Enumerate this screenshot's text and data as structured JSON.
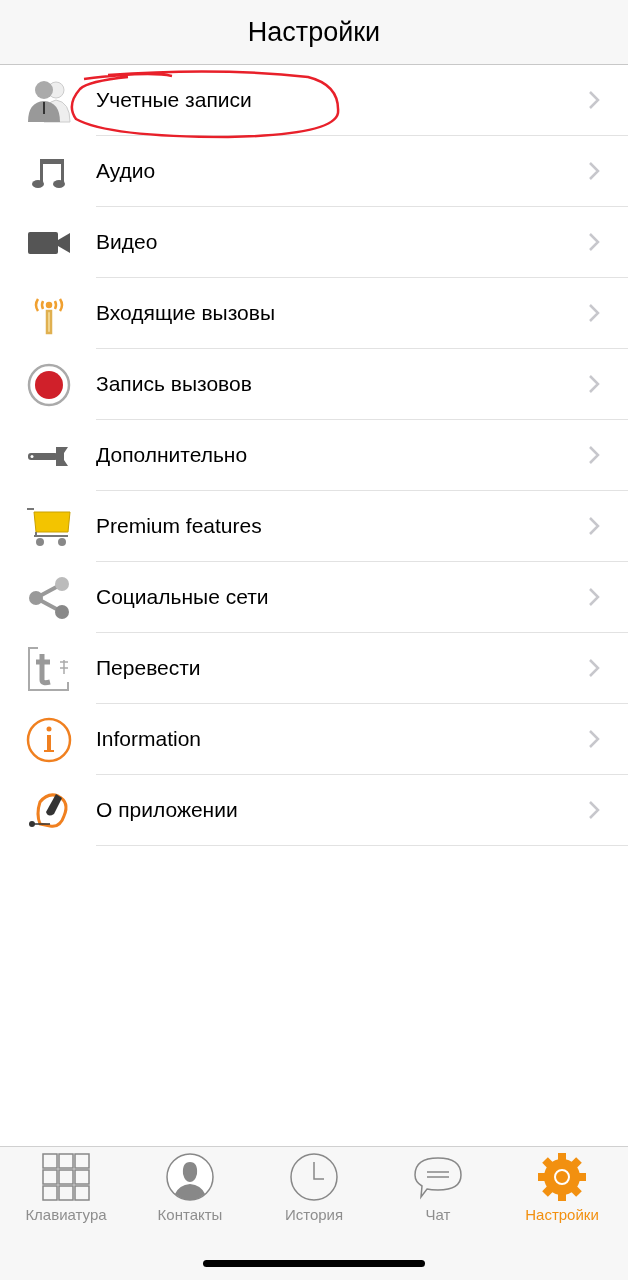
{
  "header": {
    "title": "Настройки"
  },
  "items": [
    {
      "label": "Учетные записи",
      "kind": "people",
      "highlighted": true
    },
    {
      "label": "Аудио",
      "kind": "note",
      "highlighted": false
    },
    {
      "label": "Видео",
      "kind": "camera",
      "highlighted": false
    },
    {
      "label": "Входящие вызовы",
      "kind": "antenna",
      "highlighted": false
    },
    {
      "label": "Запись вызовов",
      "kind": "record",
      "highlighted": false
    },
    {
      "label": "Дополнительно",
      "kind": "wrench",
      "highlighted": false
    },
    {
      "label": "Premium features",
      "kind": "cart",
      "highlighted": false
    },
    {
      "label": "Социальные сети",
      "kind": "share",
      "highlighted": false
    },
    {
      "label": "Перевести",
      "kind": "translate",
      "highlighted": false
    },
    {
      "label": "Information",
      "kind": "info",
      "highlighted": false
    },
    {
      "label": "О приложении",
      "kind": "headset",
      "highlighted": false
    }
  ],
  "tab_bar": [
    {
      "label": "Клавиатура",
      "kind": "keypad",
      "selected": false
    },
    {
      "label": "Контакты",
      "kind": "contact",
      "selected": false
    },
    {
      "label": "История",
      "kind": "clock",
      "selected": false
    },
    {
      "label": "Чат",
      "kind": "chat",
      "selected": false
    },
    {
      "label": "Настройки",
      "kind": "gear",
      "selected": true
    }
  ]
}
